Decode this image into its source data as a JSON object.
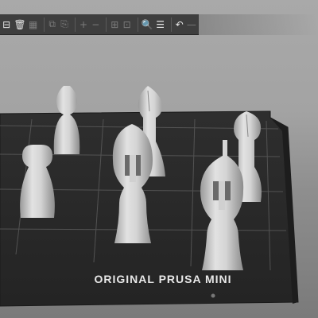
{
  "bed": {
    "label": "ORIGINAL PRUSA MINI"
  },
  "toolbar": {
    "buttons": [
      {
        "icon": "add-icon",
        "enabled": true
      },
      {
        "icon": "delete-icon",
        "enabled": true
      },
      {
        "icon": "delete-all-icon",
        "enabled": false
      },
      {
        "icon": "arrange-icon",
        "enabled": false
      },
      {
        "icon": "copy-icon",
        "enabled": false
      },
      {
        "icon": "paste-icon",
        "enabled": false
      },
      {
        "icon": "add-instance-icon",
        "enabled": false
      },
      {
        "icon": "remove-instance-icon",
        "enabled": false
      },
      {
        "icon": "split-objects-icon",
        "enabled": false
      },
      {
        "icon": "split-parts-icon",
        "enabled": false
      },
      {
        "icon": "search-icon",
        "enabled": true
      },
      {
        "icon": "layers-editing-icon",
        "enabled": true
      },
      {
        "icon": "undo-icon",
        "enabled": true
      }
    ]
  },
  "colors": {
    "background": "#9a9a9a",
    "bed": "#2b2b2b",
    "model": "#d8d8d8",
    "toolbar": "#3e3e3e"
  }
}
